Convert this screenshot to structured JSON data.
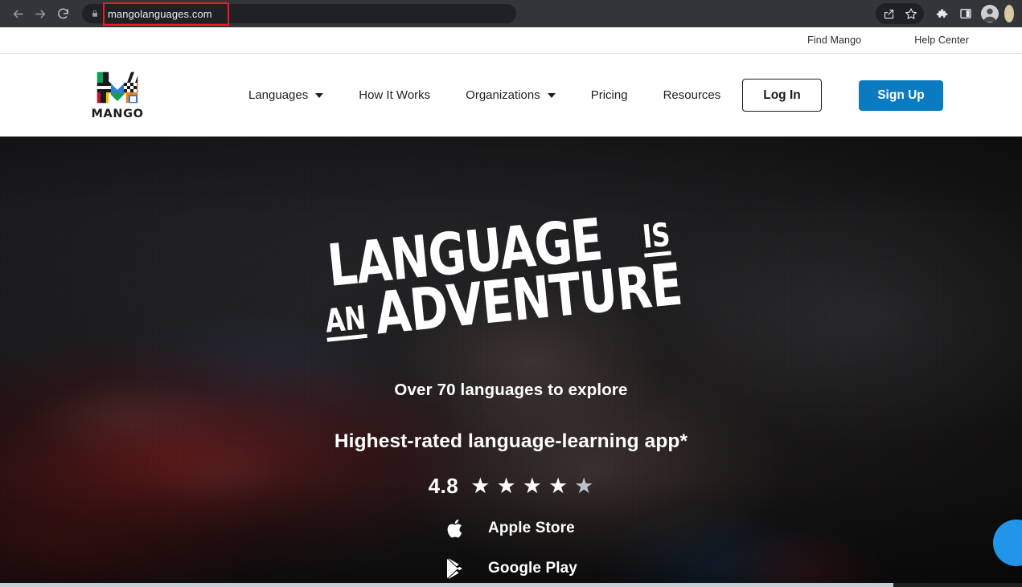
{
  "browser": {
    "back_icon": "back-arrow-icon",
    "forward_icon": "forward-arrow-icon",
    "reload_icon": "reload-icon",
    "lock_icon": "lock-icon",
    "url": "mangolanguages.com",
    "highlight_color": "#ee1b24",
    "toolbar_icons": [
      "share-icon",
      "bookmark-star-icon",
      "extensions-puzzle-icon",
      "side-panel-icon",
      "profile-avatar-icon"
    ]
  },
  "utility_nav": {
    "links": [
      {
        "label": "Find Mango"
      },
      {
        "label": "Help Center"
      }
    ]
  },
  "header": {
    "logo": {
      "wordmark": "MANGO",
      "icon": "mango-logo-icon"
    },
    "nav": [
      {
        "label": "Languages",
        "has_dropdown": true
      },
      {
        "label": "How It Works",
        "has_dropdown": false
      },
      {
        "label": "Organizations",
        "has_dropdown": true
      },
      {
        "label": "Pricing",
        "has_dropdown": false
      },
      {
        "label": "Resources",
        "has_dropdown": false
      }
    ],
    "login_label": "Log In",
    "signup_label": "Sign Up",
    "signup_color": "#0b7bc1"
  },
  "hero": {
    "headline_line1_big": "LANGUAGE",
    "headline_line1_small": "IS",
    "headline_line2_small": "AN",
    "headline_line2_big": "ADVENTURE",
    "subhead_one": "Over 70 languages to explore",
    "subhead_two": "Highest-rated language-learning app*",
    "rating_value": "4.8",
    "stars_filled": 4,
    "stars_total": 5,
    "stores": [
      {
        "label": "Apple Store",
        "icon": "apple-logo-icon"
      },
      {
        "label": "Google Play",
        "icon": "google-play-icon"
      }
    ],
    "chat_widget": "chat-bubble-icon",
    "chat_color": "#2196e8"
  }
}
